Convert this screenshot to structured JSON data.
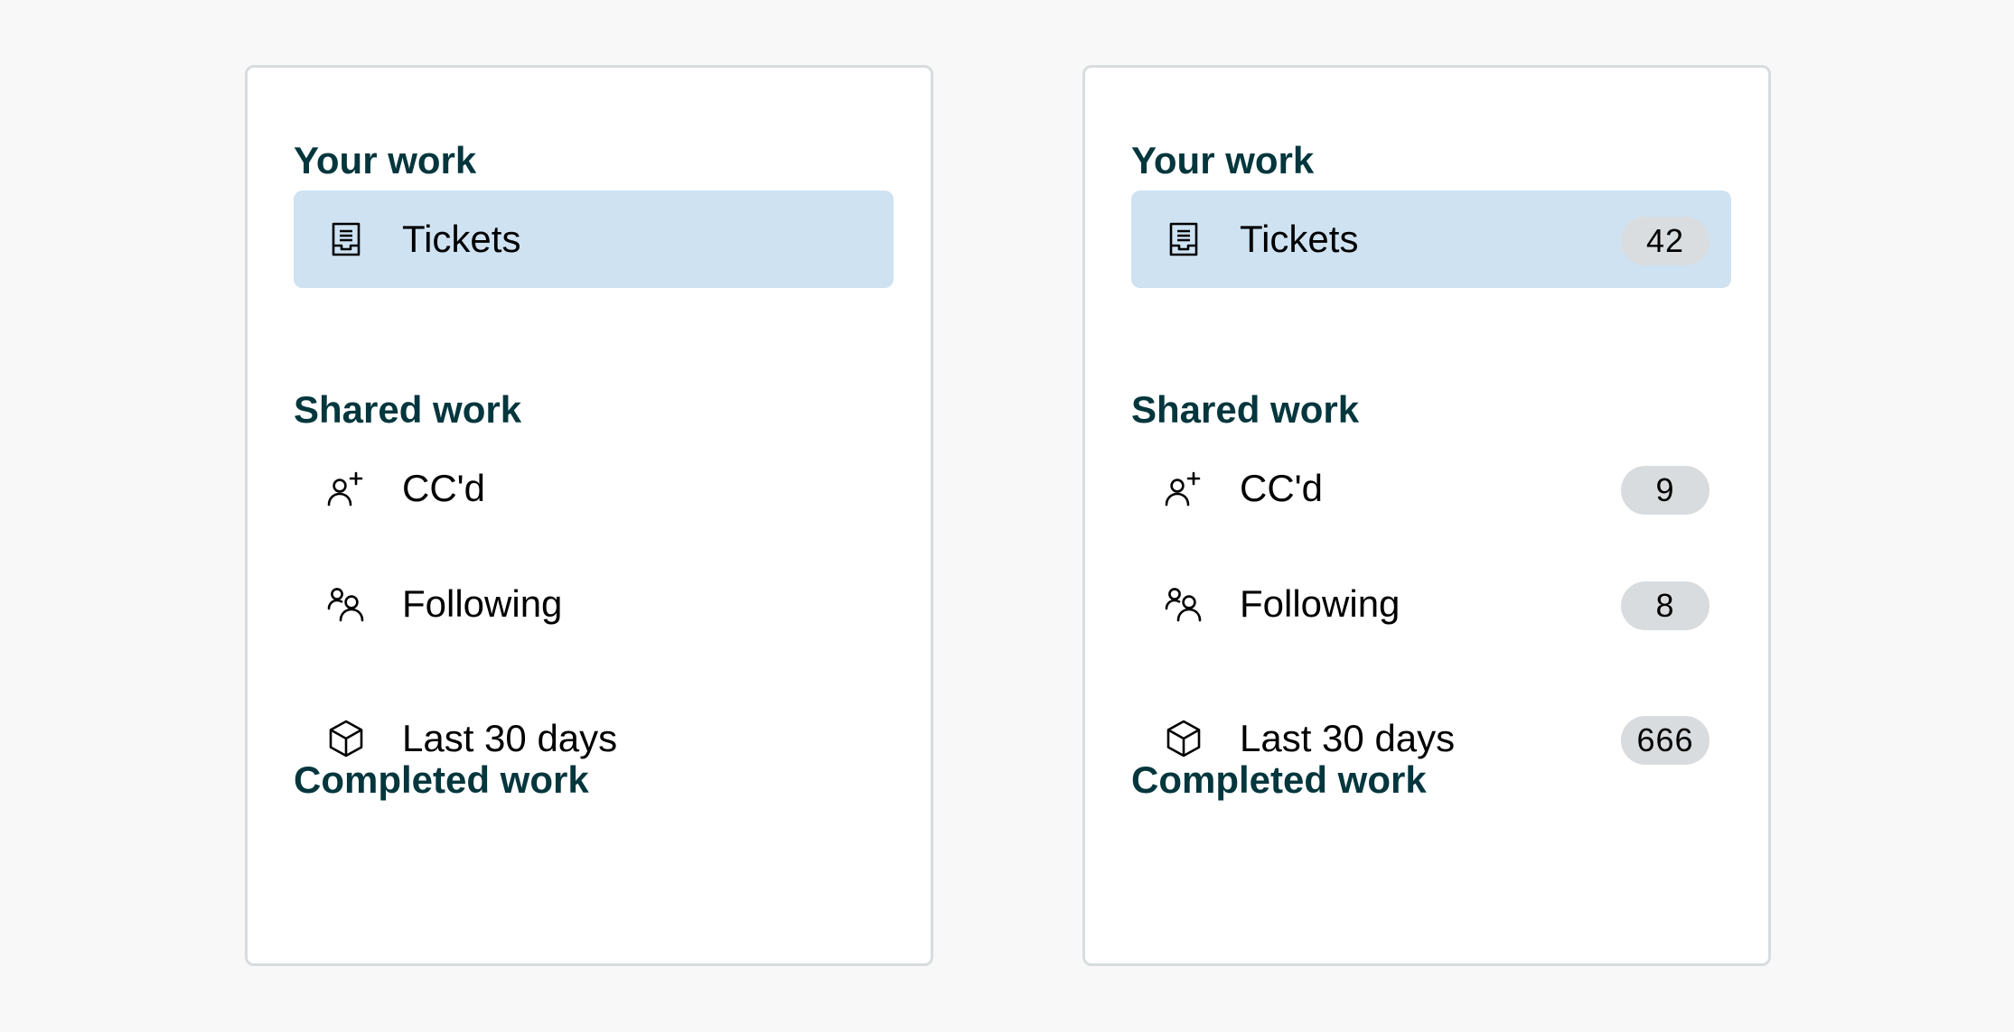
{
  "panels": {
    "left": {
      "sections": {
        "your_work": {
          "title": "Your work",
          "items": [
            {
              "label": "Tickets",
              "icon": "ticket-inbox-icon",
              "selected": true
            }
          ]
        },
        "shared_work": {
          "title": "Shared work",
          "items": [
            {
              "label": "CC'd",
              "icon": "user-plus-icon",
              "selected": false
            },
            {
              "label": "Following",
              "icon": "users-icon",
              "selected": false
            }
          ]
        },
        "completed_work": {
          "title": "Completed work",
          "items": [
            {
              "label": "Last 30 days",
              "icon": "box-icon",
              "selected": false
            }
          ]
        }
      }
    },
    "right": {
      "sections": {
        "your_work": {
          "title": "Your work",
          "items": [
            {
              "label": "Tickets",
              "icon": "ticket-inbox-icon",
              "selected": true,
              "count": "42"
            }
          ]
        },
        "shared_work": {
          "title": "Shared work",
          "items": [
            {
              "label": "CC'd",
              "icon": "user-plus-icon",
              "selected": false,
              "count": "9"
            },
            {
              "label": "Following",
              "icon": "users-icon",
              "selected": false,
              "count": "8"
            }
          ]
        },
        "completed_work": {
          "title": "Completed work",
          "items": [
            {
              "label": "Last 30 days",
              "icon": "box-icon",
              "selected": false,
              "count": "666"
            }
          ]
        }
      }
    }
  },
  "colors": {
    "page_background": "#f7f8f7",
    "panel_background": "#ffffff",
    "panel_border": "#d8dcde",
    "section_title": "#03363d",
    "selected_background": "#cee2f2",
    "badge_background": "#d8dcde"
  }
}
